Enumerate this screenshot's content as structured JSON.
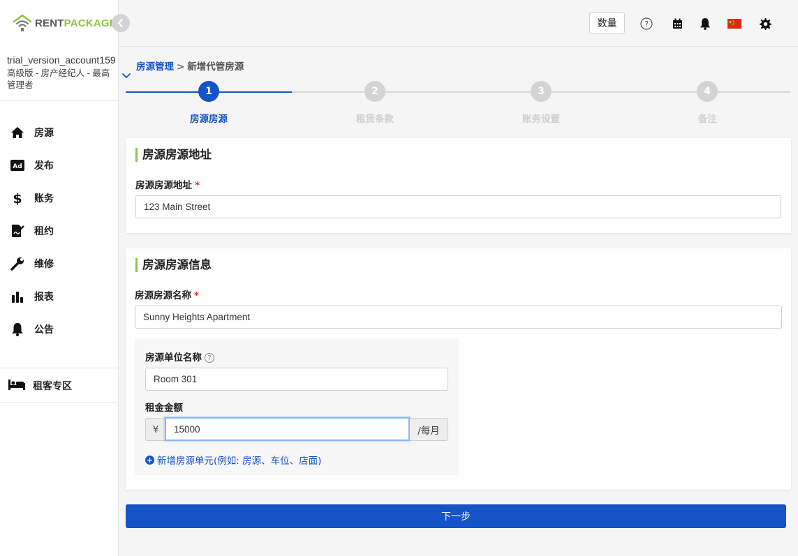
{
  "brand": {
    "part1": "RENT",
    "part2": "PACKAGE",
    "accent": "#8cc63f",
    "primary": "#1553c9"
  },
  "account": {
    "name": "trial_version_account159",
    "role": "高级版 - 房产经纪人 - 最高管理者"
  },
  "sidebar": {
    "items": [
      {
        "label": "房源",
        "icon": "home-icon"
      },
      {
        "label": "发布",
        "icon": "ad-icon"
      },
      {
        "label": "账务",
        "icon": "dollar-icon"
      },
      {
        "label": "租约",
        "icon": "contract-icon"
      },
      {
        "label": "维修",
        "icon": "wrench-icon"
      },
      {
        "label": "报表",
        "icon": "bar-chart-icon"
      },
      {
        "label": "公告",
        "icon": "bell-icon"
      }
    ],
    "tenant": {
      "label": "租客专区",
      "icon": "bed-icon"
    }
  },
  "header": {
    "quantity_label": "数量",
    "icons": [
      "help-icon",
      "calendar-icon",
      "bell-icon",
      "china-flag-icon",
      "gear-icon"
    ]
  },
  "breadcrumb": {
    "parent": "房源管理",
    "separator": ">",
    "current": "新增代管房源"
  },
  "steps": [
    {
      "number": "1",
      "label": "房源房源"
    },
    {
      "number": "2",
      "label": "租赁条款"
    },
    {
      "number": "3",
      "label": "账务设置"
    },
    {
      "number": "4",
      "label": "备注"
    }
  ],
  "address_section": {
    "title": "房源房源地址",
    "field_label": "房源房源地址",
    "required_mark": "*",
    "value": "123 Main Street"
  },
  "info_section": {
    "title": "房源房源信息",
    "name_label": "房源房源名称",
    "required_mark": "*",
    "name_value": "Sunny Heights Apartment",
    "unit_name_label": "房源单位名称",
    "help_glyph": "?",
    "unit_name_value": "Room 301",
    "rent_label": "租金金额",
    "currency": "¥",
    "rent_value": "15000",
    "per_month": "/每月",
    "add_unit_glyph": "+",
    "add_unit_label": "新增房源单元(例如: 房源、车位、店面)"
  },
  "next_button": "下一步"
}
